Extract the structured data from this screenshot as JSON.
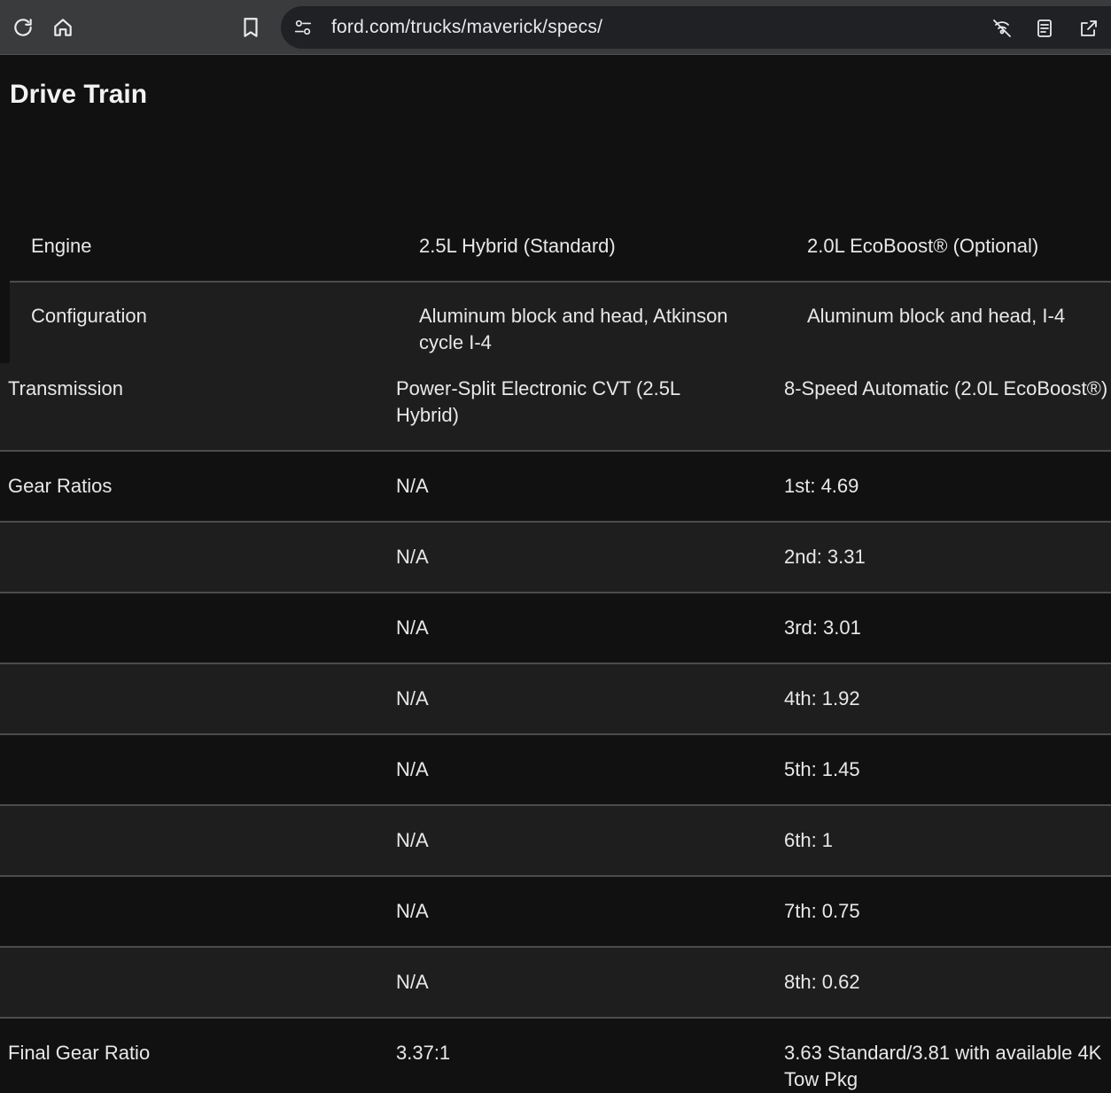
{
  "browser": {
    "url": "ford.com/trucks/maverick/specs/"
  },
  "page": {
    "title": "Drive Train"
  },
  "specs": {
    "rows": [
      {
        "label": "Engine",
        "hybrid": "2.5L Hybrid (Standard)",
        "ecoboost": "2.0L EcoBoost® (Optional)"
      },
      {
        "label": "Configuration",
        "hybrid": "Aluminum block and head, Atkinson cycle I-4",
        "ecoboost": "Aluminum block and head, I-4"
      },
      {
        "label": "Transmission",
        "hybrid": "Power-Split Electronic CVT (2.5L Hybrid)",
        "ecoboost": "8-Speed Automatic (2.0L EcoBoost®)"
      },
      {
        "label": "Gear Ratios",
        "hybrid": "N/A",
        "ecoboost": "1st: 4.69"
      },
      {
        "label": "",
        "hybrid": "N/A",
        "ecoboost": "2nd: 3.31"
      },
      {
        "label": "",
        "hybrid": "N/A",
        "ecoboost": "3rd: 3.01"
      },
      {
        "label": "",
        "hybrid": "N/A",
        "ecoboost": "4th: 1.92"
      },
      {
        "label": "",
        "hybrid": "N/A",
        "ecoboost": "5th: 1.45"
      },
      {
        "label": "",
        "hybrid": "N/A",
        "ecoboost": "6th: 1"
      },
      {
        "label": "",
        "hybrid": "N/A",
        "ecoboost": "7th: 0.75"
      },
      {
        "label": "",
        "hybrid": "N/A",
        "ecoboost": "8th: 0.62"
      },
      {
        "label": "Final Gear Ratio",
        "hybrid": "3.37:1",
        "ecoboost": "3.63 Standard/3.81 with available 4K Tow Pkg"
      }
    ]
  }
}
